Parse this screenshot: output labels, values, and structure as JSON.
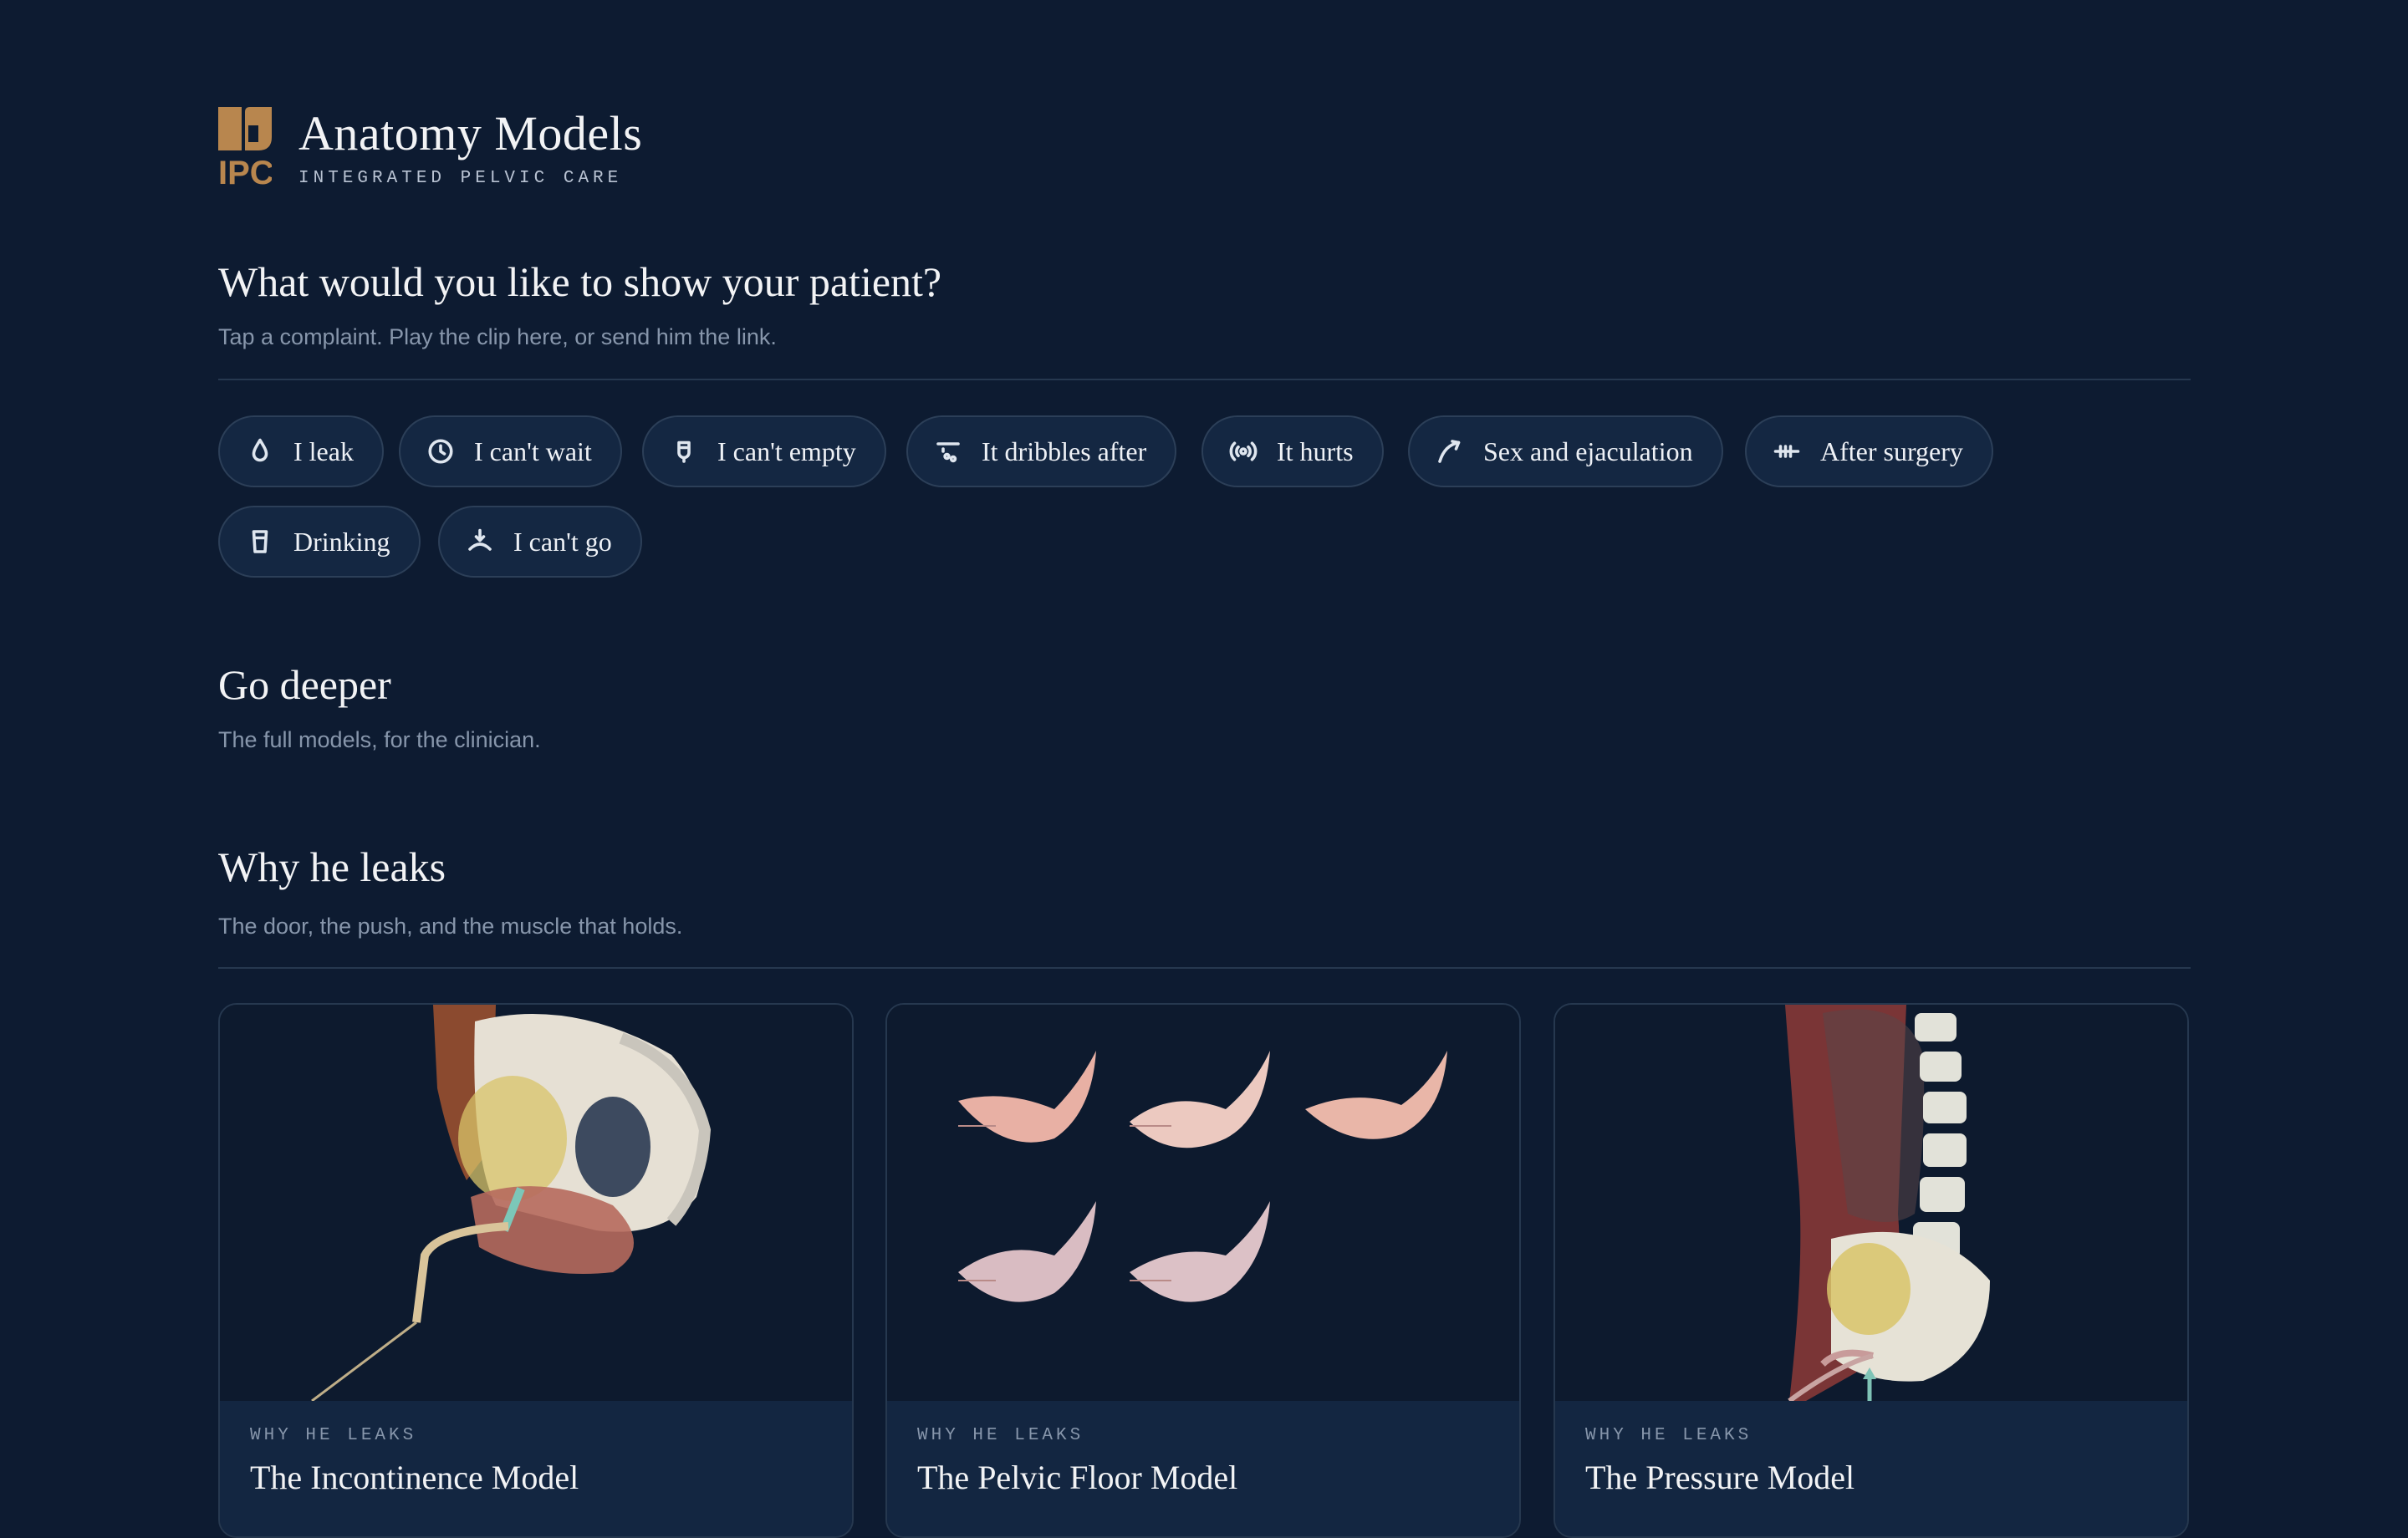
{
  "header": {
    "logo_text": "IPC",
    "title": "Anatomy Models",
    "subtitle": "INTEGRATED PELVIC CARE"
  },
  "intro": {
    "heading": "What would you like to show your patient?",
    "subheading": "Tap a complaint. Play the clip here, or send him the link."
  },
  "complaints": [
    {
      "label": "I leak",
      "icon": "droplet-icon"
    },
    {
      "label": "I can't wait",
      "icon": "clock-icon"
    },
    {
      "label": "I can't empty",
      "icon": "bladder-icon"
    },
    {
      "label": "It dribbles after",
      "icon": "drip-icon"
    },
    {
      "label": "It hurts",
      "icon": "pain-signal-icon"
    },
    {
      "label": "Sex and ejaculation",
      "icon": "arc-arrow-icon"
    },
    {
      "label": "After surgery",
      "icon": "stitches-icon"
    },
    {
      "label": "Drinking",
      "icon": "cup-icon"
    },
    {
      "label": "I can't go",
      "icon": "blocked-flow-icon"
    }
  ],
  "deeper": {
    "heading": "Go deeper",
    "subheading": "The full models, for the clinician."
  },
  "section": {
    "heading": "Why he leaks",
    "subheading": "The door, the push, and the muscle that holds."
  },
  "cards": [
    {
      "kicker": "WHY HE LEAKS",
      "title": "The Incontinence Model"
    },
    {
      "kicker": "WHY HE LEAKS",
      "title": "The Pelvic Floor Model"
    },
    {
      "kicker": "WHY HE LEAKS",
      "title": "The Pressure Model"
    }
  ],
  "colors": {
    "background": "#0d1b31",
    "brand": "#b8864e",
    "chip_background": "#142742",
    "chip_border": "#2c3f58",
    "muted_text": "#8796ab"
  }
}
